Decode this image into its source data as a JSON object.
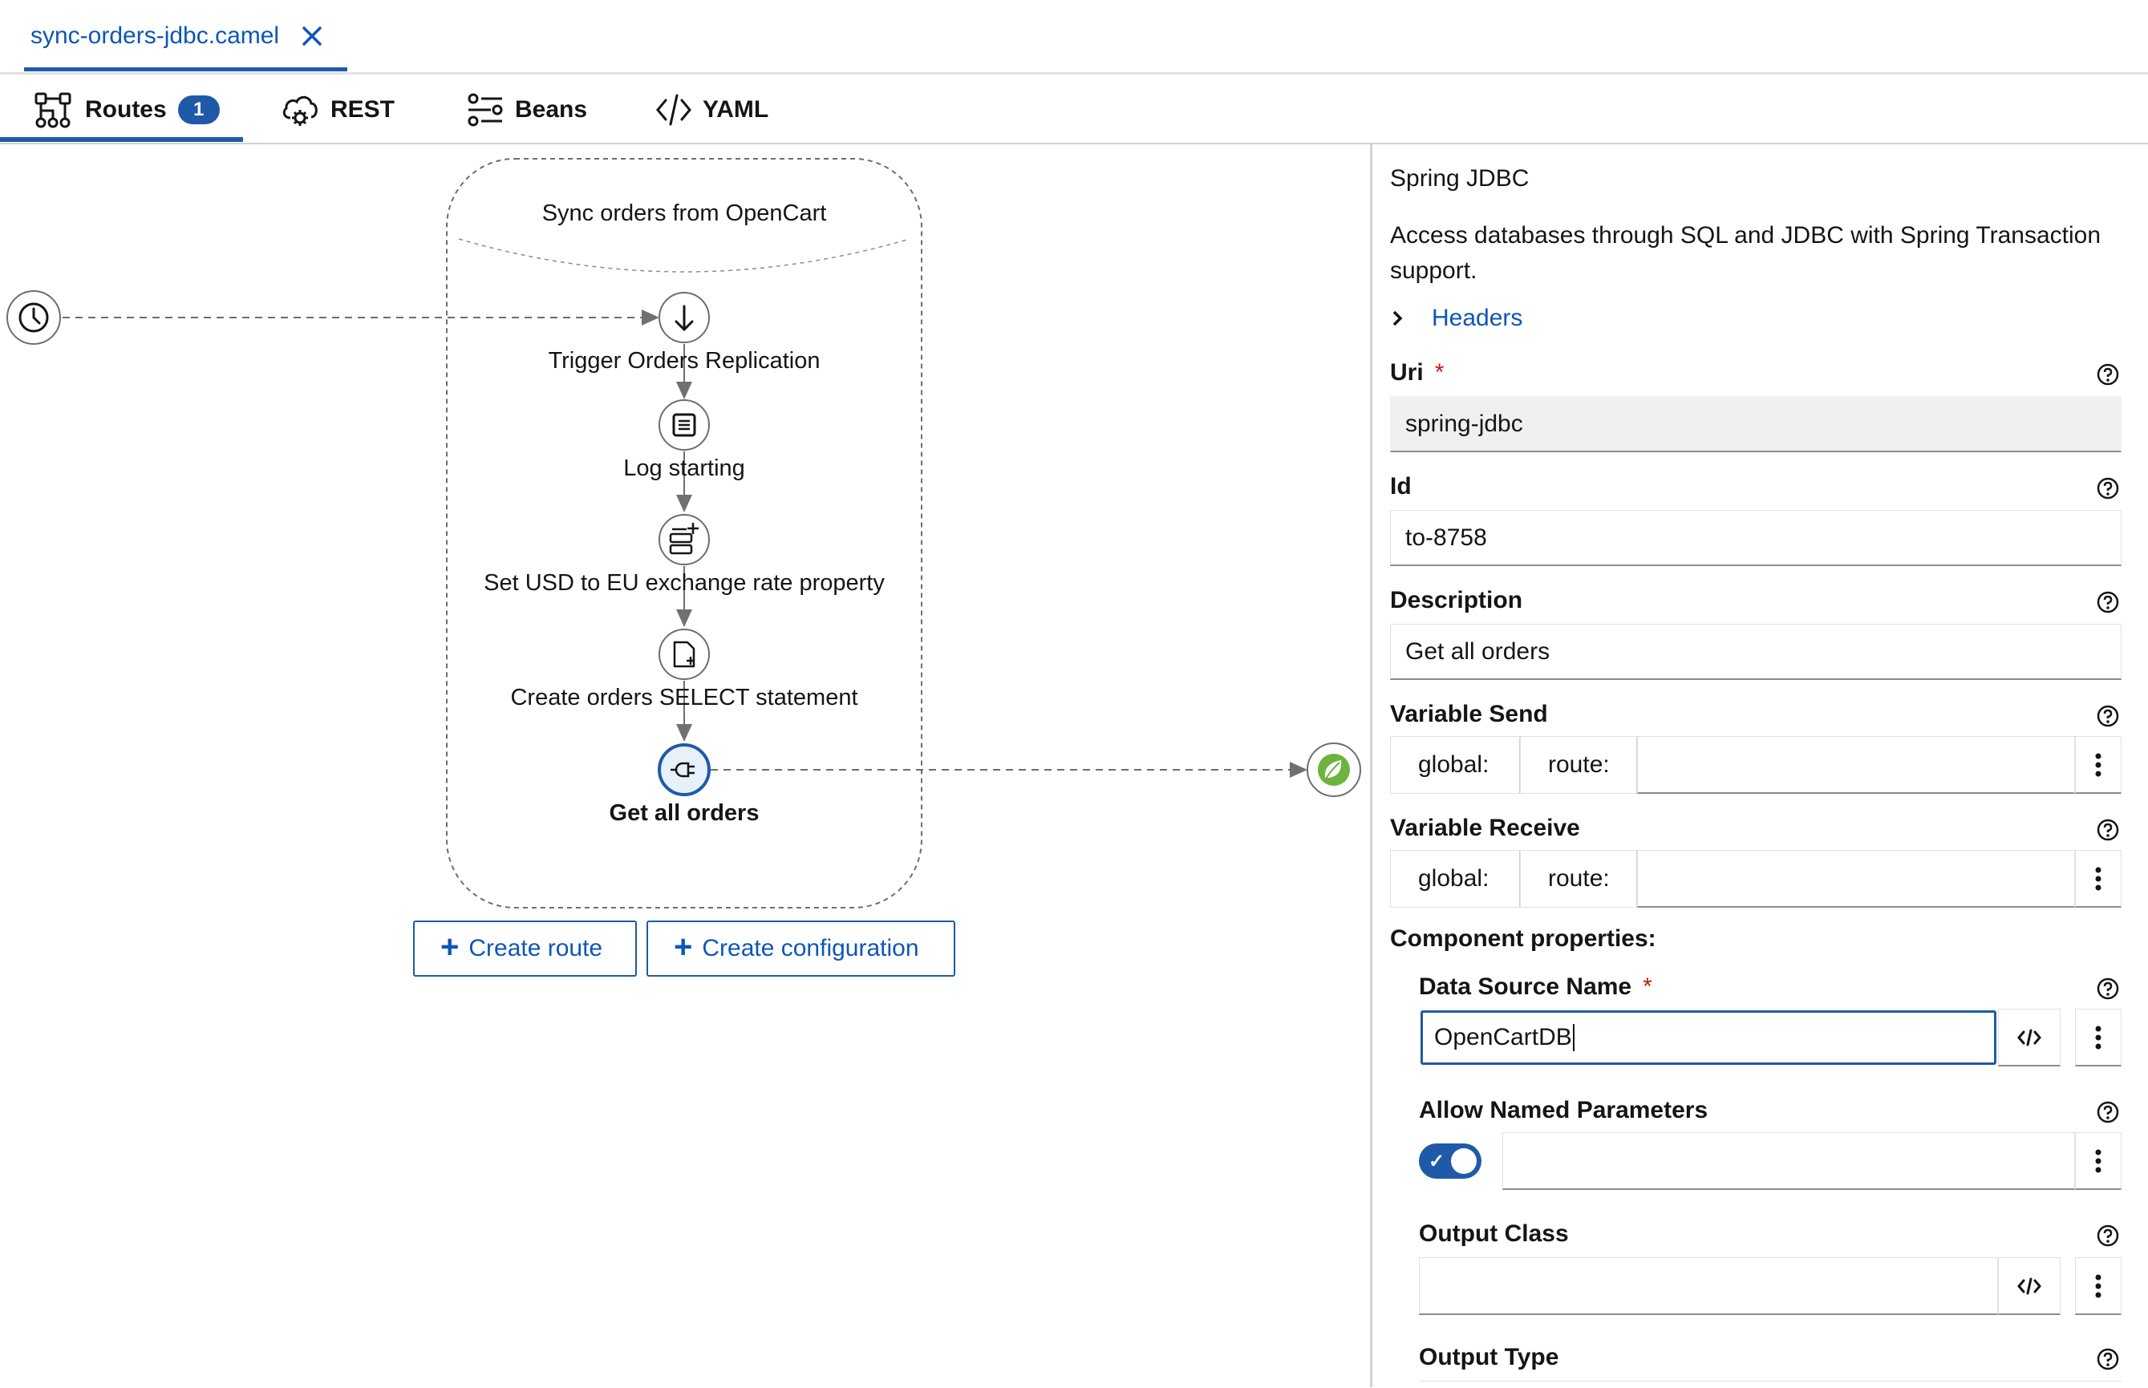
{
  "file_tab": {
    "name": "sync-orders-jdbc.camel"
  },
  "nav": {
    "routes_label": "Routes",
    "routes_count": "1",
    "rest_label": "REST",
    "beans_label": "Beans",
    "yaml_label": "YAML"
  },
  "canvas": {
    "route_title": "Sync orders from OpenCart",
    "steps": [
      "Trigger Orders Replication",
      "Log starting",
      "Set USD to EU exchange rate property",
      "Create orders SELECT statement",
      "Get all orders"
    ],
    "create_route_label": "Create route",
    "create_configuration_label": "Create configuration"
  },
  "panel": {
    "title": "Spring JDBC",
    "description": "Access databases through SQL and JDBC with Spring Transaction support.",
    "headers_label": "Headers",
    "uri_label": "Uri",
    "uri_value": "spring-jdbc",
    "id_label": "Id",
    "id_value": "to-8758",
    "description_label": "Description",
    "description_value": "Get all orders",
    "variable_send_label": "Variable Send",
    "variable_receive_label": "Variable Receive",
    "var_global": "global:",
    "var_route": "route:",
    "component_properties_label": "Component properties:",
    "data_source_name_label": "Data Source Name",
    "data_source_name_value": "OpenCartDB",
    "allow_named_parameters_label": "Allow Named Parameters",
    "allow_named_parameters_value": true,
    "output_class_label": "Output Class",
    "output_class_value": "",
    "output_type_label": "Output Type",
    "required_marker": "*"
  },
  "colors": {
    "accent": "#1f5aa8",
    "required": "#c9190b",
    "link": "#0e56b8"
  }
}
